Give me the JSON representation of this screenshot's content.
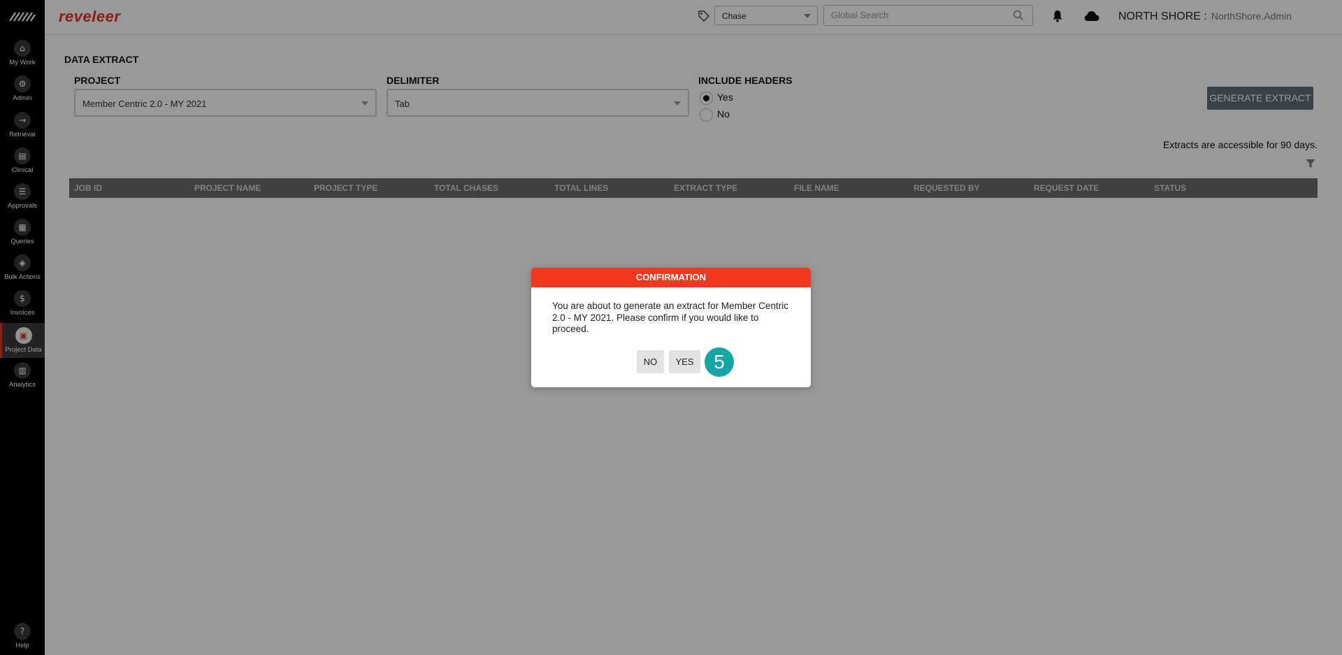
{
  "app": {
    "brand": "reveleer"
  },
  "sidebar": {
    "items": [
      {
        "label": "My Work",
        "icon": "home-icon",
        "glyph": "⌂"
      },
      {
        "label": "Admin",
        "icon": "admin-gear-icon",
        "glyph": "⚙"
      },
      {
        "label": "Retrieval",
        "icon": "retrieval-arrow-icon",
        "glyph": "→"
      },
      {
        "label": "Clinical",
        "icon": "clinical-clipboard-icon",
        "glyph": "▤"
      },
      {
        "label": "Approvals",
        "icon": "approvals-list-icon",
        "glyph": "☰"
      },
      {
        "label": "Queries",
        "icon": "queries-icon",
        "glyph": "▦"
      },
      {
        "label": "Bulk Actions",
        "icon": "bulk-actions-layers-icon",
        "glyph": "◈"
      },
      {
        "label": "Invoices",
        "icon": "invoices-dollar-icon",
        "glyph": "$"
      },
      {
        "label": "Project Data",
        "icon": "project-data-icon",
        "glyph": "▣"
      },
      {
        "label": "Analytics",
        "icon": "analytics-chart-icon",
        "glyph": "▥"
      }
    ],
    "help": {
      "label": "Help",
      "glyph": "?"
    }
  },
  "header": {
    "chase_select_value": "Chase",
    "search_placeholder": "Global Search",
    "org_name": "NORTH SHORE :",
    "user_name": "NorthShore.Admin"
  },
  "main": {
    "title": "DATA EXTRACT",
    "project_label": "PROJECT",
    "project_value": "Member Centric 2.0 - MY 2021",
    "delimiter_label": "DELIMITER",
    "delimiter_value": "Tab",
    "include_headers_label": "INCLUDE HEADERS",
    "radio_yes": "Yes",
    "radio_no": "No",
    "include_headers_selected": "Yes",
    "generate_button": "GENERATE EXTRACT",
    "note": "Extracts are accessible for 90 days.",
    "table_columns": [
      "JOB ID",
      "PROJECT NAME",
      "PROJECT TYPE",
      "TOTAL CHASES",
      "TOTAL LINES",
      "EXTRACT TYPE",
      "FILE NAME",
      "REQUESTED BY",
      "REQUEST DATE",
      "STATUS"
    ]
  },
  "modal": {
    "title": "CONFIRMATION",
    "message": "You are about to generate an extract for Member Centric 2.0 - MY 2021. Please confirm if you would like to proceed.",
    "no_label": "NO",
    "yes_label": "YES"
  },
  "step_badge": "5",
  "colors": {
    "brand": "#e5352c",
    "modal_header": "#f2371e",
    "badge": "#16a5a5",
    "sidebar": "#000000",
    "table_header": "#6b6b6b",
    "generate_button": "#5f6f7b"
  }
}
